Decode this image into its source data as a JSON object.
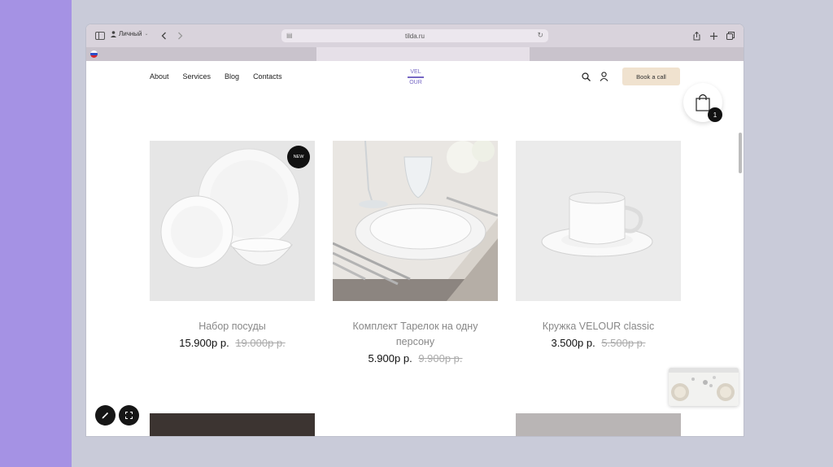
{
  "browser": {
    "profile_label": "Личный",
    "url": "tilda.ru"
  },
  "site": {
    "nav": [
      "About",
      "Services",
      "Blog",
      "Contacts"
    ],
    "logo_top": "VEL",
    "logo_bottom": "OUR",
    "book_button": "Book a call",
    "cart_count": "1"
  },
  "products": [
    {
      "name": "Набор посуды",
      "price": "15.900р р.",
      "old_price": "19.000р р.",
      "badge": "NEW"
    },
    {
      "name": "Комплект Тарелок на одну персону",
      "price": "5.900р р.",
      "old_price": "9.900р р."
    },
    {
      "name": "Кружка VELOUR classic",
      "price": "3.500р р.",
      "old_price": "5.500р р."
    }
  ],
  "colors": {
    "accent": "#7667c4",
    "book_button_bg": "#f0e2cf",
    "left_band": "#a592e4",
    "background": "#c9cbd9"
  },
  "icons": {
    "sidebar": "sidebar-icon",
    "back": "chevron-left-icon",
    "forward": "chevron-right-icon",
    "share": "share-icon",
    "new_tab": "plus-icon",
    "tabs": "tabs-overview-icon",
    "search": "search-icon",
    "user": "user-icon",
    "cart": "shopping-bag-icon",
    "edit": "pencil-icon",
    "fullscreen": "fullscreen-icon"
  }
}
